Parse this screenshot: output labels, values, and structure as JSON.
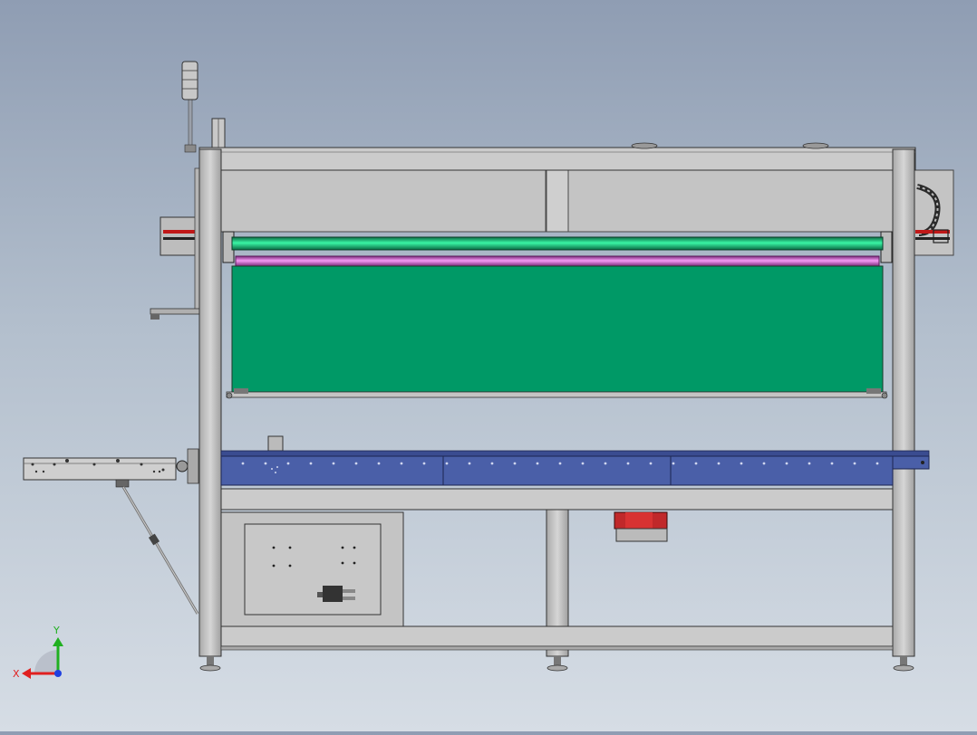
{
  "viewport": {
    "background_top": "#8f9db3",
    "background_bottom": "#d6dde5"
  },
  "machine": {
    "frame_color": "#c8c8c8",
    "panel_color": "#c2c2c2",
    "screen_color": "#009966",
    "roller_green": "#1ee08a",
    "roller_magenta": "#e070e0",
    "conveyor_color": "#4a5fa8",
    "motor_color": "#c0282a"
  },
  "triad": {
    "x_label": "X",
    "y_label": "Y",
    "x_color": "#e02020",
    "y_color": "#20b020",
    "z_color": "#2040e0"
  }
}
